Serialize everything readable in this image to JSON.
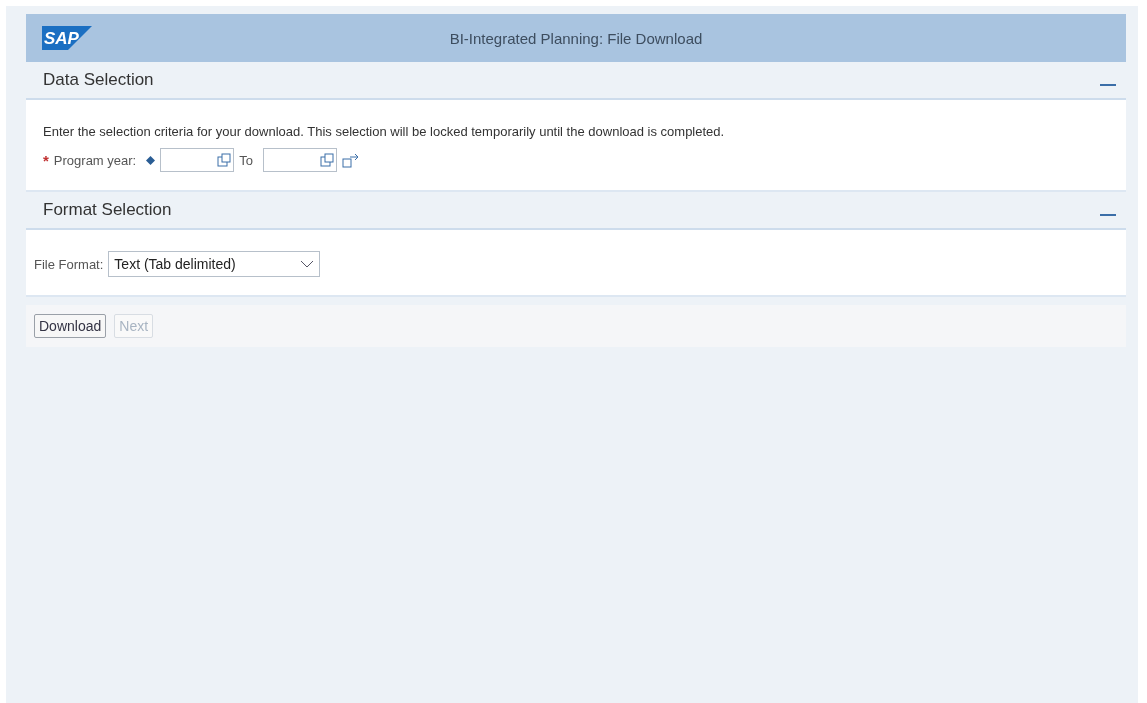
{
  "header": {
    "logo": "SAP",
    "title": "BI-Integrated Planning: File Download"
  },
  "data_selection": {
    "title": "Data Selection",
    "expanded": true,
    "instruction": "Enter the selection criteria for your download. This selection will be locked temporarily until the download is completed.",
    "field": {
      "label": "Program year:",
      "required_mark": "*",
      "range_separator": "To"
    }
  },
  "format_selection": {
    "title": "Format Selection",
    "expanded": true,
    "field": {
      "label": "File Format:",
      "value": "Text (Tab delimited)"
    }
  },
  "buttons": [
    {
      "label": "Download",
      "disabled": false
    },
    {
      "label": "Next",
      "disabled": true
    }
  ]
}
